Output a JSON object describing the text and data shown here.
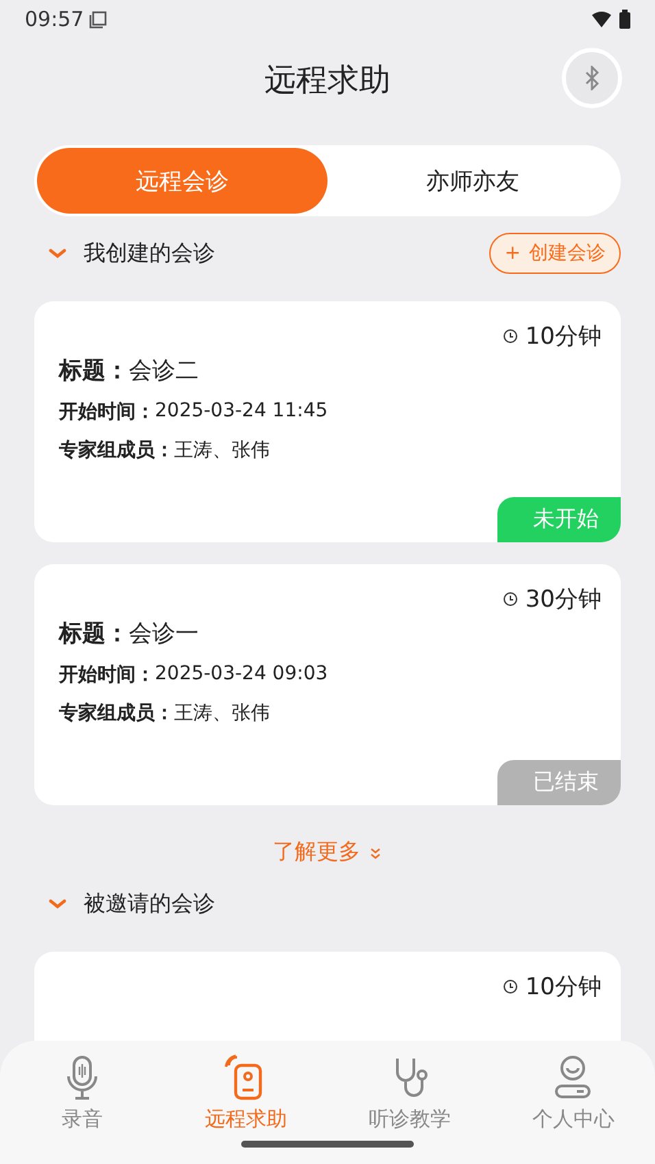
{
  "status_bar": {
    "time": "09:57"
  },
  "header": {
    "title": "远程求助"
  },
  "tabs": [
    {
      "label": "远程会诊",
      "selected": true
    },
    {
      "label": "亦师亦友",
      "selected": false
    }
  ],
  "created_section": {
    "title": "我创建的会诊",
    "expanded": true,
    "action": {
      "icon": "+",
      "label": "创建会诊"
    },
    "cards": [
      {
        "duration": "10分钟",
        "title_label": "标题：",
        "title": "会诊二",
        "start_label": "开始时间：",
        "start": "2025-03-24 11:45",
        "members_label": "专家组成员：",
        "members": "王涛、张伟",
        "status": "未开始",
        "color": "#22d15f"
      },
      {
        "duration": "30分钟",
        "title_label": "标题：",
        "title": "会诊一",
        "start_label": "开始时间：",
        "start": "2025-03-24 09:03",
        "members_label": "专家组成员：",
        "members": "王涛、张伟",
        "status": "已结束",
        "color": "#b3b3b3"
      }
    ],
    "more": "了解更多"
  },
  "invited_section": {
    "title": "被邀请的会诊",
    "expanded": true,
    "cards": [
      {
        "duration": "10分钟"
      }
    ]
  },
  "bottom_nav": [
    {
      "label": "录音",
      "kind": "mic",
      "selected": false
    },
    {
      "label": "远程求助",
      "kind": "remote",
      "selected": true
    },
    {
      "label": "听诊教学",
      "kind": "stethoscope",
      "selected": false
    },
    {
      "label": "个人中心",
      "kind": "person",
      "selected": false
    }
  ]
}
